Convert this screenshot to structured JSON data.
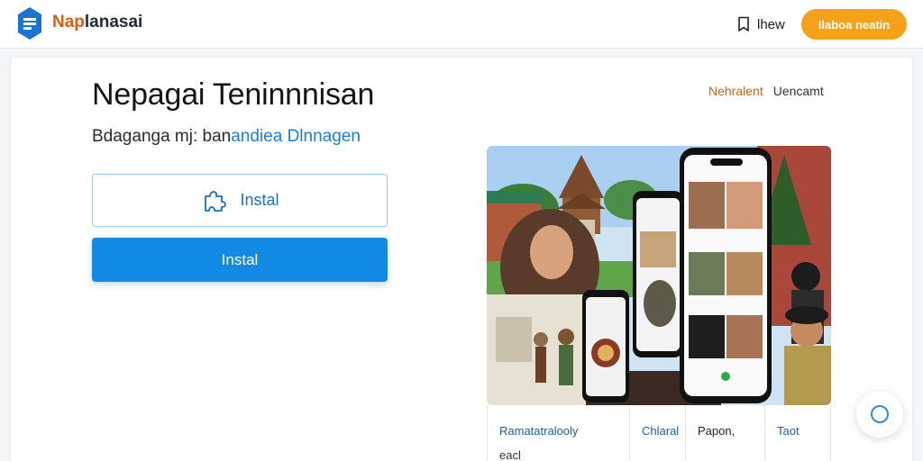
{
  "header": {
    "brand_prefix": "Nap",
    "brand_suffix": "lanasai",
    "news_label": "lhew",
    "cta_label": "Ilaboa neatin"
  },
  "hero": {
    "title": "Nepagai Teninnnisan",
    "subtitle_plain": "Bdaganga mj: ban",
    "subtitle_link": "andiea Dlnnagen",
    "primary_outline_label": "Instal",
    "primary_solid_label": "Instal"
  },
  "top_links": [
    "Nehralent",
    "Uencamt"
  ],
  "info_strip": {
    "col1_title": "Ramatatralooly",
    "col1_sub": "eacl",
    "col2_title": "Chlaral",
    "col3_title": "Papon,",
    "col4_title": "Taot"
  },
  "colors": {
    "accent_orange": "#f5a21a",
    "primary_blue": "#1289e5",
    "logo_blue": "#1a73d1"
  },
  "icons": {
    "logo": "app-logo-icon",
    "news": "bookmark-icon",
    "outline_button": "puzzle-icon",
    "fab": "chat-circle-icon"
  }
}
